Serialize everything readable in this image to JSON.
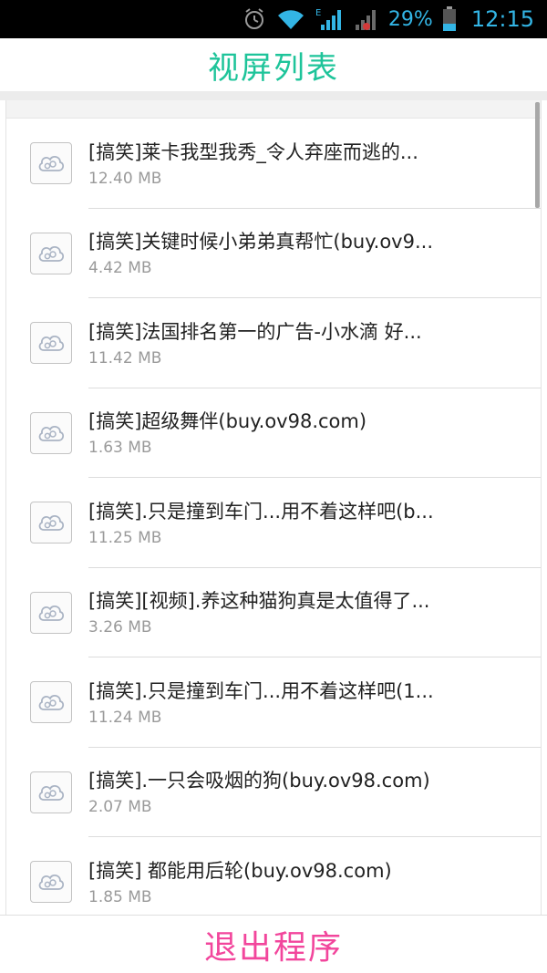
{
  "status_bar": {
    "icons": [
      "alarm-icon",
      "wifi-icon",
      "signal-icon",
      "battery-icon"
    ],
    "network_label": "E",
    "battery": "29%",
    "time": "12:15"
  },
  "header": {
    "title": "视屏列表"
  },
  "videos": [
    {
      "title": "[搞笑]莱卡我型我秀_令人弃座而逃的...",
      "size": "12.40 MB",
      "icon": "cloud-video-icon"
    },
    {
      "title": "[搞笑]关键时候小弟弟真帮忙(buy.ov9...",
      "size": "4.42 MB",
      "icon": "cloud-video-icon"
    },
    {
      "title": "[搞笑]法国排名第一的广告-小水滴 好...",
      "size": "11.42 MB",
      "icon": "cloud-video-icon"
    },
    {
      "title": "[搞笑]超级舞伴(buy.ov98.com)",
      "size": "1.63 MB",
      "icon": "cloud-video-icon"
    },
    {
      "title": "[搞笑].只是撞到车门...用不着这样吧(b...",
      "size": "11.25 MB",
      "icon": "cloud-video-icon"
    },
    {
      "title": "[搞笑][视频].养这种猫狗真是太值得了...",
      "size": "3.26 MB",
      "icon": "cloud-video-icon"
    },
    {
      "title": "[搞笑].只是撞到车门...用不着这样吧(1...",
      "size": "11.24 MB",
      "icon": "cloud-video-icon"
    },
    {
      "title": "[搞笑].一只会吸烟的狗(buy.ov98.com)",
      "size": "2.07 MB",
      "icon": "cloud-video-icon"
    },
    {
      "title": "[搞笑] 都能用后轮(buy.ov98.com)",
      "size": "1.85 MB",
      "icon": "cloud-video-icon"
    }
  ],
  "footer": {
    "exit_label": "退出程序"
  },
  "colors": {
    "title": "#1ec49a",
    "exit": "#f2469c",
    "status": "#33b5e5"
  }
}
